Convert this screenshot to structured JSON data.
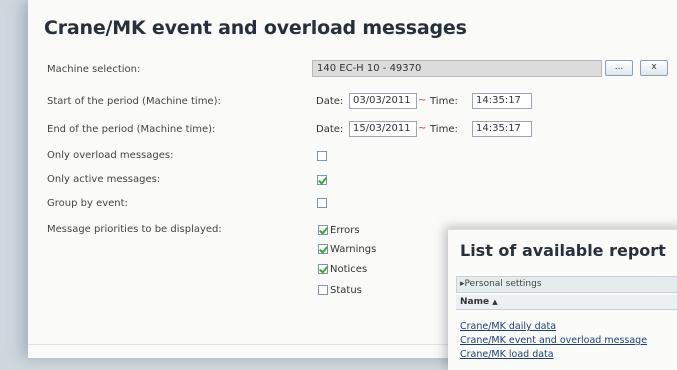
{
  "title": "Crane/MK event and overload messages",
  "form": {
    "machine_label": "Machine selection:",
    "machine_value": "140 EC-H 10 - 49370",
    "browse_label": "...",
    "clear_label": "x",
    "start_label": "Start of the period (Machine time):",
    "end_label": "End of the period (Machine time):",
    "date_label": "Date:",
    "time_label": "Time:",
    "separator": "~",
    "start_date": "03/03/2011",
    "start_time": "14:35:17",
    "end_date": "15/03/2011",
    "end_time": "14:35:17",
    "overload_label": "Only overload messages:",
    "active_label": "Only active messages:",
    "group_label": "Group by event:",
    "priorities_label": "Message priorities to be displayed:",
    "overload_checked": false,
    "active_checked": true,
    "group_checked": false,
    "priorities": [
      {
        "label": "Errors",
        "checked": true
      },
      {
        "label": "Warnings",
        "checked": true
      },
      {
        "label": "Notices",
        "checked": true
      },
      {
        "label": "Status",
        "checked": false
      }
    ]
  },
  "reports": {
    "title": "List of available report",
    "personal_settings": "Personal settings",
    "column_name": "Name",
    "sort_indicator": "▲",
    "items": [
      "Crane/MK daily data",
      "Crane/MK event and overload message",
      "Crane/MK load data"
    ]
  }
}
